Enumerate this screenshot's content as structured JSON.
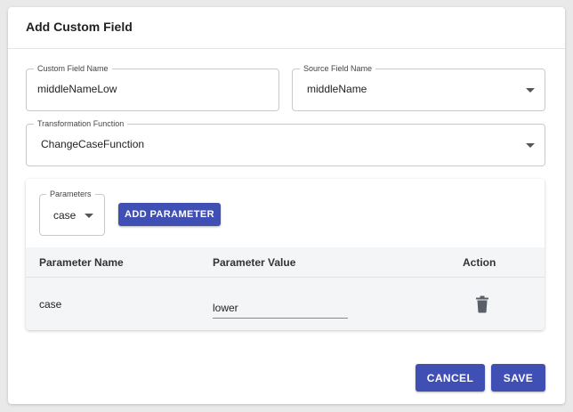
{
  "dialog": {
    "title": "Add Custom Field"
  },
  "custom_field_name": {
    "label": "Custom Field Name",
    "value": "middleNameLow"
  },
  "source_field_name": {
    "label": "Source Field Name",
    "value": "middleName"
  },
  "transformation_function": {
    "label": "Transformation Function",
    "value": "ChangeCaseFunction"
  },
  "parameters": {
    "select_label": "Parameters",
    "select_value": "case",
    "add_button_label": "ADD PARAMETER",
    "table": {
      "columns": [
        "Parameter Name",
        "Parameter Value",
        "Action"
      ],
      "rows": [
        {
          "name": "case",
          "value": "lower",
          "action_icon": "delete-icon"
        }
      ]
    }
  },
  "footer": {
    "cancel_label": "CANCEL",
    "save_label": "SAVE"
  },
  "colors": {
    "primary": "#3f4fb4",
    "table_bg": "#f4f5f7",
    "icon_gray": "#5a6069"
  }
}
